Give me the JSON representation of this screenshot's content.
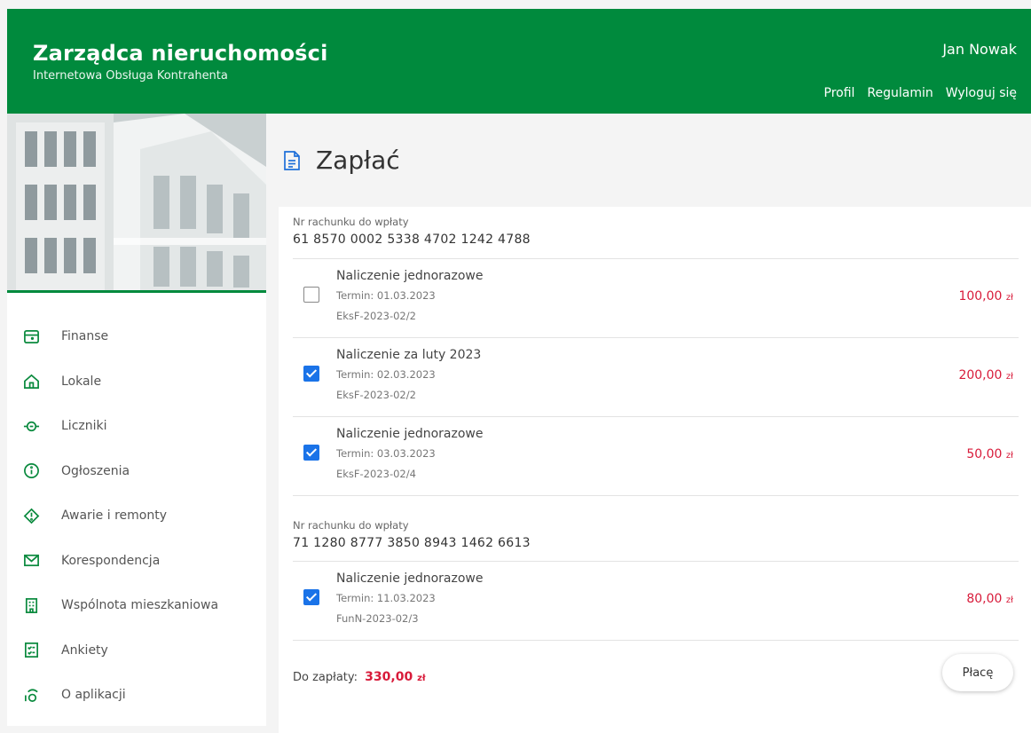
{
  "header": {
    "title": "Zarządca nieruchomości",
    "subtitle": "Internetowa Obsługa Kontrahenta",
    "user_name": "Jan Nowak",
    "links": {
      "profile": "Profil",
      "rules": "Regulamin",
      "logout": "Wyloguj się"
    }
  },
  "sidebar": {
    "items": [
      {
        "label": "Finanse",
        "icon": "wallet-icon"
      },
      {
        "label": "Lokale",
        "icon": "home-icon"
      },
      {
        "label": "Liczniki",
        "icon": "meter-icon"
      },
      {
        "label": "Ogłoszenia",
        "icon": "info-icon"
      },
      {
        "label": "Awarie i remonty",
        "icon": "alert-icon"
      },
      {
        "label": "Korespondencja",
        "icon": "mail-icon"
      },
      {
        "label": "Wspólnota mieszkaniowa",
        "icon": "building-icon"
      },
      {
        "label": "Ankiety",
        "icon": "survey-icon"
      },
      {
        "label": "O aplikacji",
        "icon": "about-icon"
      }
    ]
  },
  "main": {
    "title": "Zapłać",
    "accounts": [
      {
        "label": "Nr rachunku do wpłaty",
        "number": "61 8570 0002 5338 4702 1242 4788",
        "charges": [
          {
            "name": "Naliczenie jednorazowe",
            "term": "Termin: 01.03.2023",
            "ref": "EksF-2023-02/2",
            "amount": "100,00",
            "currency": "zł",
            "checked": false
          },
          {
            "name": "Naliczenie za luty 2023",
            "term": "Termin: 02.03.2023",
            "ref": "EksF-2023-02/2",
            "amount": "200,00",
            "currency": "zł",
            "checked": true
          },
          {
            "name": "Naliczenie jednorazowe",
            "term": "Termin: 03.03.2023",
            "ref": "EksF-2023-02/4",
            "amount": "50,00",
            "currency": "zł",
            "checked": true
          }
        ]
      },
      {
        "label": "Nr rachunku do wpłaty",
        "number": "71 1280 8777 3850 8943 1462 6613",
        "charges": [
          {
            "name": "Naliczenie jednorazowe",
            "term": "Termin: 11.03.2023",
            "ref": "FunN-2023-02/3",
            "amount": "80,00",
            "currency": "zł",
            "checked": true
          }
        ]
      }
    ],
    "total_label": "Do zapłaty:",
    "total_value": "330,00",
    "total_currency": "zł",
    "pay_button": "Płacę"
  },
  "colors": {
    "brand": "#008a3d",
    "accent": "#1a73e8",
    "amount": "#d81b3a"
  }
}
